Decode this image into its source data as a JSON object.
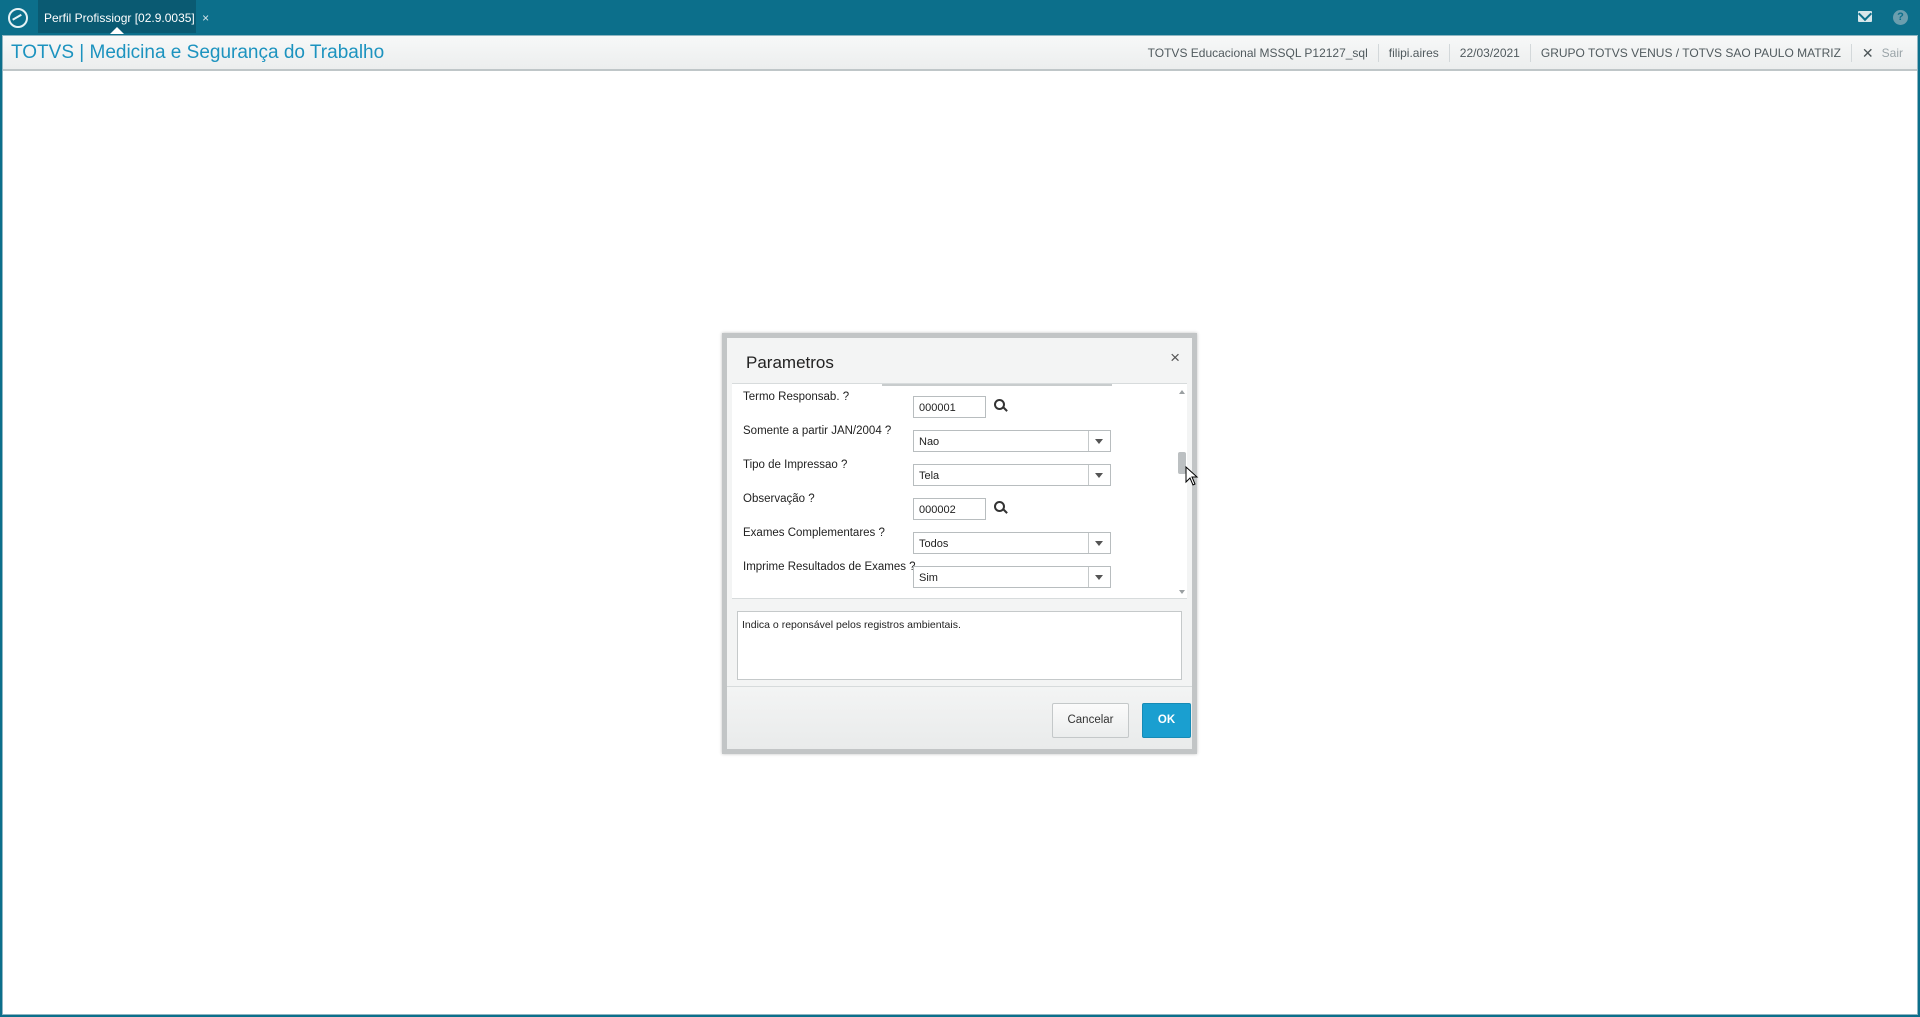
{
  "tabs": [
    {
      "label": "Perfil Profissiogr [02.9.0035]",
      "close": "×"
    }
  ],
  "header": {
    "title": "TOTVS | Medicina e Segurança do Trabalho",
    "environment": "TOTVS Educacional MSSQL P12127_sql",
    "user": "filipi.aires",
    "date": "22/03/2021",
    "company": "GRUPO TOTVS VENUS / TOTVS SAO PAULO MATRIZ",
    "logout_label": "Sair"
  },
  "dialog": {
    "title": "Parametros",
    "close": "×",
    "params": [
      {
        "label": "Termo Responsab. ?",
        "value": "000001",
        "type": "lookup"
      },
      {
        "label": "Somente a partir JAN/2004 ?",
        "value": "Nao",
        "type": "combo"
      },
      {
        "label": "Tipo de Impressao ?",
        "value": "Tela",
        "type": "combo"
      },
      {
        "label": "Observação ?",
        "value": "000002",
        "type": "lookup"
      },
      {
        "label": "Exames Complementares ?",
        "value": "Todos",
        "type": "combo"
      },
      {
        "label": "Imprime Resultados de Exames ?",
        "value": "Sim",
        "type": "combo"
      }
    ],
    "help_text": "Indica o reponsável pelos registros ambientais.",
    "cancel_label": "Cancelar",
    "ok_label": "OK"
  },
  "colors": {
    "topbar": "#0c6f8b",
    "title_blue": "#1c93bf",
    "ok_button": "#1a9fd0"
  }
}
